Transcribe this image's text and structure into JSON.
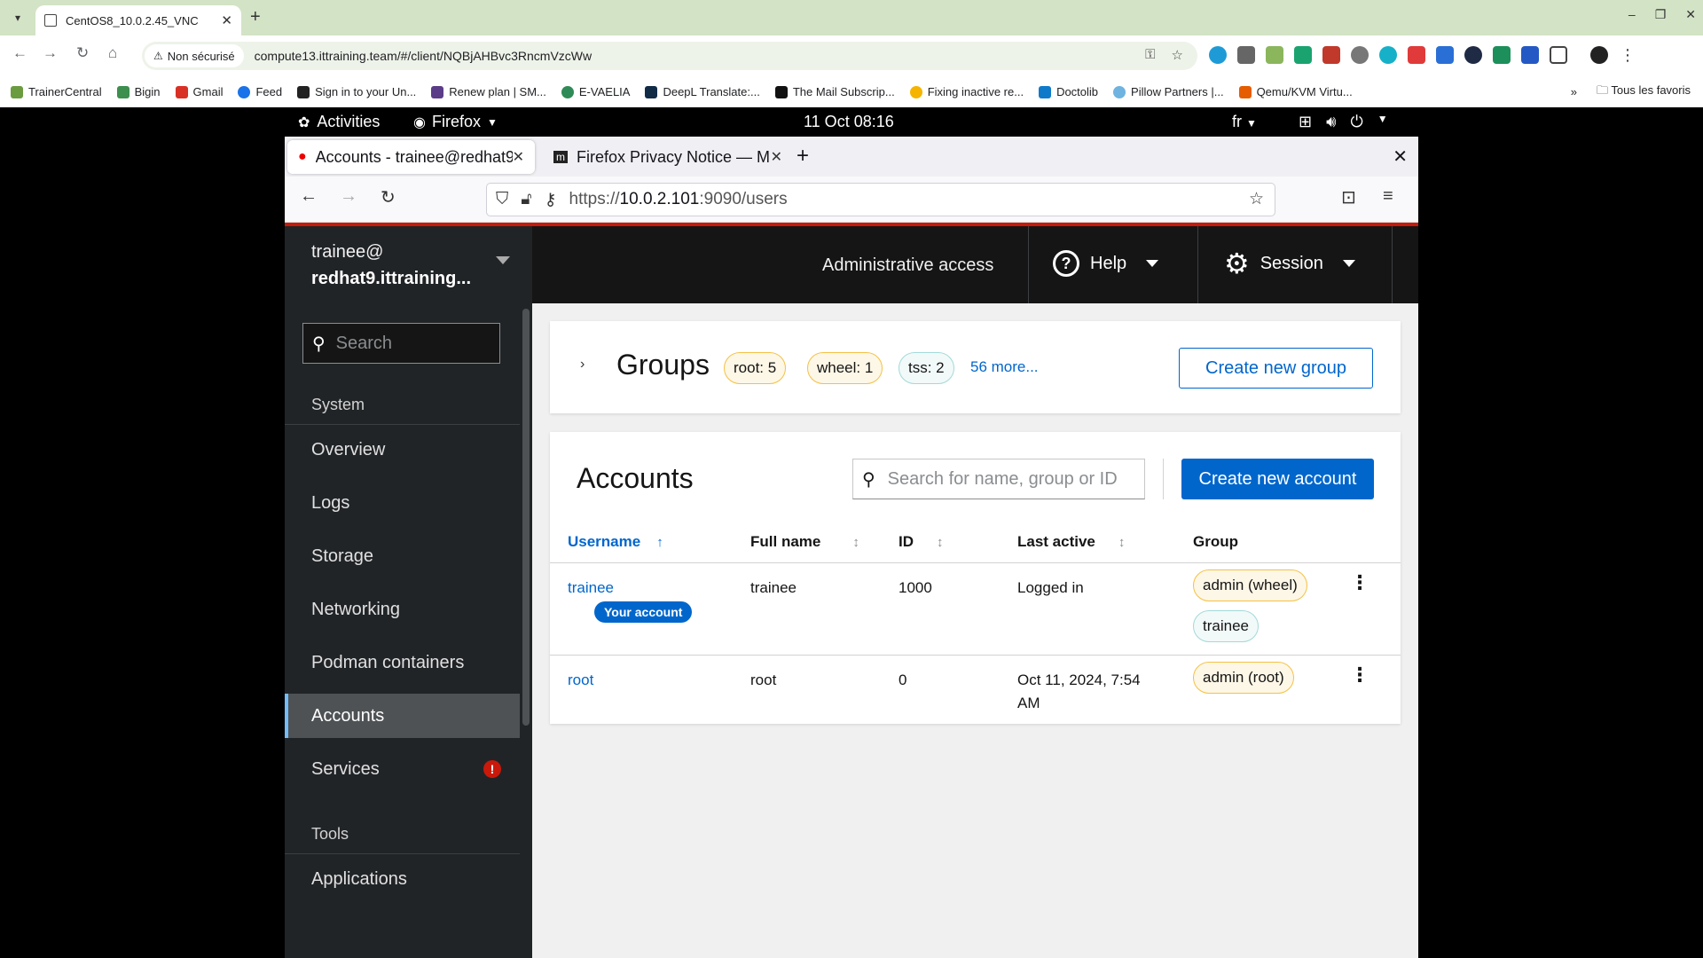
{
  "chrome": {
    "tab_title": "CentOS8_10.0.2.45_VNC",
    "insecure_label": "Non sécurisé",
    "url": "compute13.ittraining.team/#/client/NQBjAHBvc3RncmVzcWw",
    "bookmarks": [
      {
        "label": "TrainerCentral",
        "color": "#6a9c3f"
      },
      {
        "label": "Bigin",
        "color": "#3d8f4d"
      },
      {
        "label": "Gmail",
        "color": "#d93025"
      },
      {
        "label": "Feed",
        "color": "#1a73e8"
      },
      {
        "label": "Sign in to your Un...",
        "color": "#222222"
      },
      {
        "label": "Renew plan | SM...",
        "color": "#5b3c88"
      },
      {
        "label": "E-VAELIA",
        "color": "#2e8b57"
      },
      {
        "label": "DeepL Translate:...",
        "color": "#0f2b46"
      },
      {
        "label": "The Mail Subscrip...",
        "color": "#111111"
      },
      {
        "label": "Fixing inactive re...",
        "color": "#f4b400"
      },
      {
        "label": "Doctolib",
        "color": "#107aca"
      },
      {
        "label": "Pillow Partners |...",
        "color": "#6fb3e0"
      },
      {
        "label": "Qemu/KVM Virtu...",
        "color": "#e65c00"
      }
    ],
    "bookmarks_more": "»",
    "all_bookmarks": "Tous les favoris"
  },
  "gnome": {
    "activities": "Activities",
    "app_menu": "Firefox",
    "clock": "11 Oct  08:16",
    "lang": "fr"
  },
  "firefox": {
    "tabs": [
      {
        "label": "Accounts - trainee@redhat9"
      },
      {
        "label": "Firefox Privacy Notice — M"
      }
    ],
    "url_prefix": "https://",
    "url_host": "10.0.2.101",
    "url_rest": ":9090/users"
  },
  "cockpit": {
    "user": "trainee@",
    "host": "redhat9.ittraining...",
    "admin_access": "Administrative access",
    "help": "Help",
    "session": "Session",
    "sidebar": {
      "search_placeholder": "Search",
      "group_system": "System",
      "items": [
        "Overview",
        "Logs",
        "Storage",
        "Networking",
        "Podman containers",
        "Accounts",
        "Services"
      ],
      "group_tools": "Tools",
      "tools_items": [
        "Applications"
      ]
    },
    "groups": {
      "title": "Groups",
      "chips": [
        "root: 5",
        "wheel: 1",
        "tss: 2"
      ],
      "more": "56 more...",
      "create_button": "Create new group"
    },
    "accounts": {
      "title": "Accounts",
      "search_placeholder": "Search for name, group or ID",
      "create_button": "Create new account",
      "columns": [
        "Username",
        "Full name",
        "ID",
        "Last active",
        "Group"
      ],
      "your_account_badge": "Your account",
      "rows": [
        {
          "username": "trainee",
          "full_name": "trainee",
          "id": "1000",
          "last_active": "Logged in",
          "groups": [
            "admin (wheel)",
            "trainee"
          ]
        },
        {
          "username": "root",
          "full_name": "root",
          "id": "0",
          "last_active_1": "Oct 11, 2024, 7:54",
          "last_active_2": "AM",
          "groups": [
            "admin (root)"
          ]
        }
      ]
    }
  }
}
